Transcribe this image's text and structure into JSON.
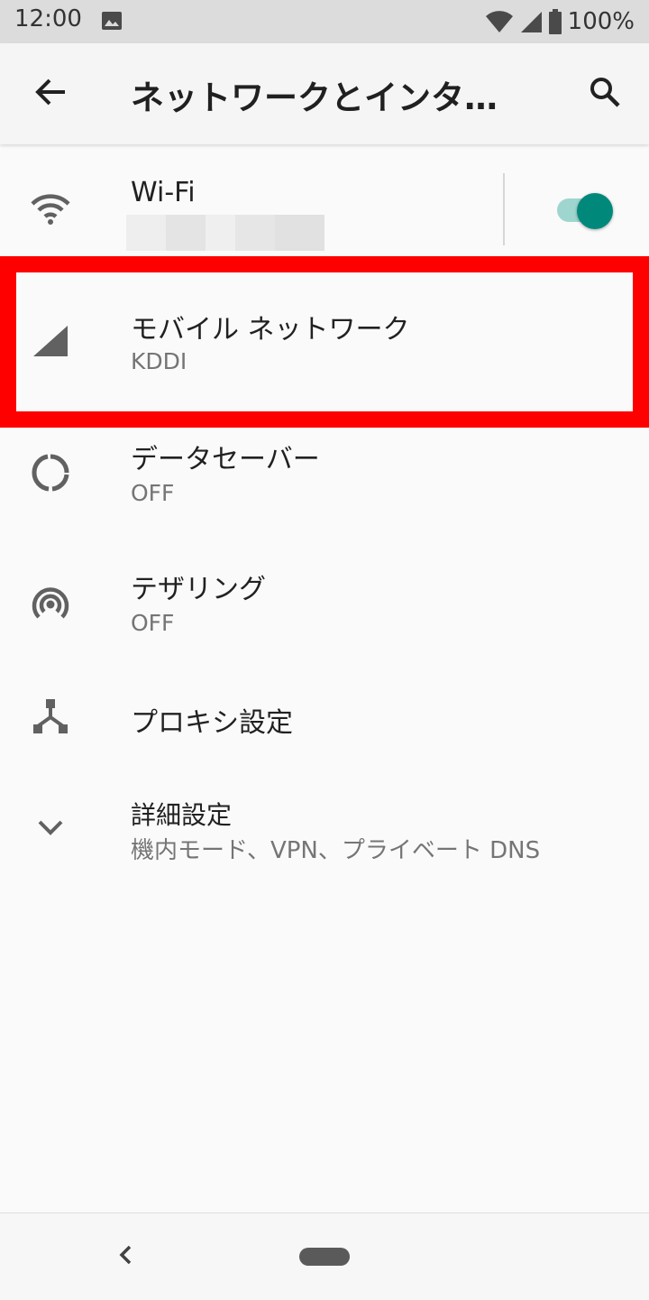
{
  "status_bar": {
    "time": "12:00",
    "battery": "100%"
  },
  "app_bar": {
    "title": "ネットワークとインターネット"
  },
  "items": [
    {
      "title": "Wi-Fi",
      "toggle_on": true
    },
    {
      "title": "モバイル ネットワーク",
      "subtitle": "KDDI"
    },
    {
      "title": "データセーバー",
      "subtitle": "OFF"
    },
    {
      "title": "テザリング",
      "subtitle": "OFF"
    },
    {
      "title": "プロキシ設定"
    },
    {
      "title": "詳細設定",
      "subtitle": "機内モード、VPN、プライベート DNS"
    }
  ],
  "icons": {
    "status": [
      "image-icon",
      "wifi-icon",
      "cell-signal-icon",
      "battery-icon"
    ],
    "app_bar": [
      "back-arrow-icon",
      "search-icon"
    ],
    "items": [
      "wifi-icon",
      "cell-signal-icon",
      "data-saver-icon",
      "hotspot-icon",
      "proxy-icon",
      "chevron-down-icon"
    ],
    "nav": [
      "nav-back-icon",
      "home-pill"
    ]
  },
  "colors": {
    "accent": "#00897b",
    "highlight": "#ff0000"
  }
}
